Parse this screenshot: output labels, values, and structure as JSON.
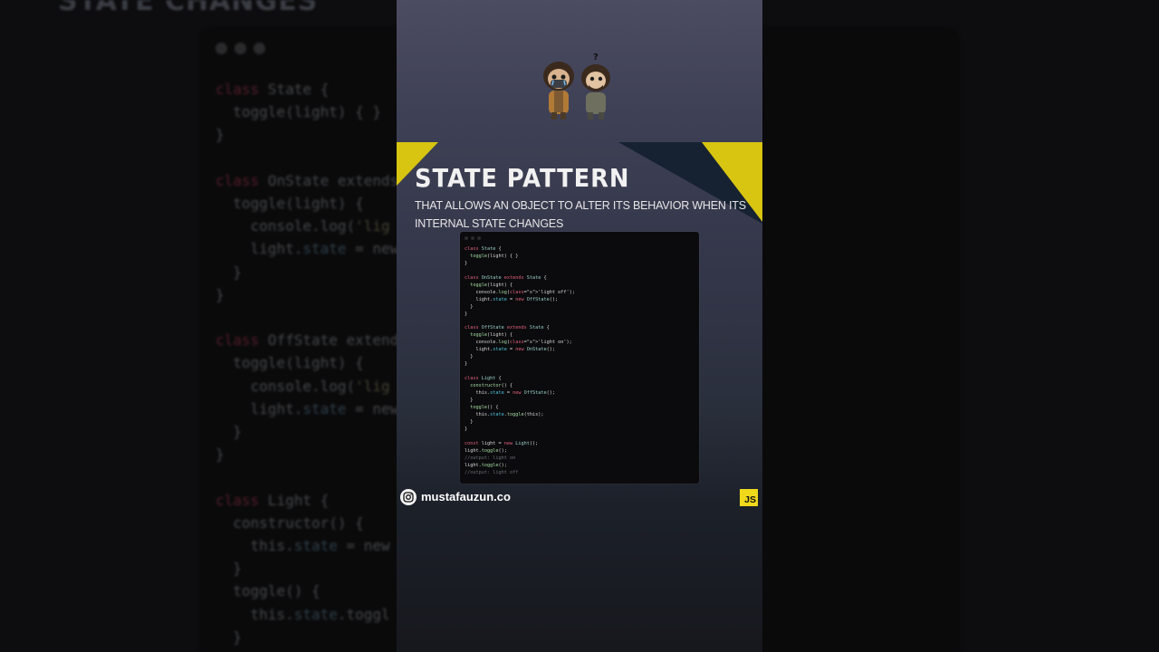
{
  "background": {
    "title": "STATE CHANGES",
    "code_lines": [
      {
        "t": "class State {",
        "k": "class"
      },
      {
        "t": "  toggle(light) { }"
      },
      {
        "t": "}"
      },
      {
        "t": ""
      },
      {
        "t": "class OnState extends",
        "k": "class"
      },
      {
        "t": "  toggle(light) {"
      },
      {
        "t": "    console.log('lig"
      },
      {
        "t": "    light.state = new"
      },
      {
        "t": "  }"
      },
      {
        "t": "}"
      },
      {
        "t": ""
      },
      {
        "t": "class OffState extend",
        "k": "class"
      },
      {
        "t": "  toggle(light) {"
      },
      {
        "t": "    console.log('lig"
      },
      {
        "t": "    light.state = new"
      },
      {
        "t": "  }"
      },
      {
        "t": "}"
      },
      {
        "t": ""
      },
      {
        "t": "class Light {",
        "k": "class"
      },
      {
        "t": "  constructor() {"
      },
      {
        "t": "    this.state = new"
      },
      {
        "t": "  }"
      },
      {
        "t": "  toggle() {"
      },
      {
        "t": "    this.state.toggl"
      },
      {
        "t": "  }"
      }
    ]
  },
  "header": {
    "title": "STATE PATTERN",
    "subtitle": "THAT ALLOWS AN OBJECT TO ALTER ITS BEHAVIOR WHEN ITS INTERNAL STATE CHANGES"
  },
  "code": [
    "class State {",
    "  toggle(light) { }",
    "}",
    "",
    "class OnState extends State {",
    "  toggle(light) {",
    "    console.log('light off');",
    "    light.state = new OffState();",
    "  }",
    "}",
    "",
    "class OffState extends State {",
    "  toggle(light) {",
    "    console.log('light on');",
    "    light.state = new OnState();",
    "  }",
    "}",
    "",
    "class Light {",
    "  constructor() {",
    "    this.state = new OffState();",
    "  }",
    "  toggle() {",
    "    this.state.toggle(this);",
    "  }",
    "}",
    "",
    "const light = new Light();",
    "light.toggle();",
    "//output: light on",
    "light.toggle();",
    "//output: light off"
  ],
  "footer": {
    "handle": "mustafauzun.co",
    "badge": "JS"
  },
  "colors": {
    "accent_yellow": "#d8c511",
    "banner_dark": "#162231",
    "js_yellow": "#f0d91b",
    "keyword": "#e0607a"
  },
  "icons": {
    "social": "instagram-icon",
    "language": "javascript-badge"
  }
}
